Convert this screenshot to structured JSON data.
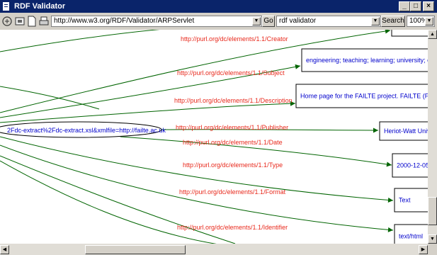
{
  "window": {
    "title": "RDF Validator"
  },
  "toolbar": {
    "url": "http://www.w3.org/RDF/Validator/ARPServlet",
    "go_label": "Go",
    "search_query": "rdf validator",
    "search_label": "Search",
    "zoom": "100%"
  },
  "graph": {
    "subject_label": "2Fdc-extract%2Fdc-extract.xsl&xmlfile=http://failte.ac.uk",
    "edges": [
      {
        "predicate": "http://purl.org/dc/elements/1.1/Creator",
        "object": ""
      },
      {
        "predicate": "http://purl.org/dc/elements/1.1/Subject",
        "object": "engineering; teaching; learning; university; co"
      },
      {
        "predicate": "http://purl.org/dc/elements/1.1/Description",
        "object": "Home page for the FAILTE project. FAILTE (Fac"
      },
      {
        "predicate": "http://purl.org/dc/elements/1.1/Publisher",
        "object": "Heriot-Watt Unive"
      },
      {
        "predicate": "http://purl.org/dc/elements/1.1/Date",
        "object": "2000-12-05"
      },
      {
        "predicate": "http://purl.org/dc/elements/1.1/Type",
        "object": "Text"
      },
      {
        "predicate": "http://purl.org/dc/elements/1.1/Format",
        "object": "text/html"
      },
      {
        "predicate": "http://purl.org/dc/elements/1.1/Identifier",
        "object": ""
      }
    ],
    "colors": {
      "edge": "#006400",
      "predicate": "#e8291c",
      "literal": "#0000cc"
    }
  }
}
